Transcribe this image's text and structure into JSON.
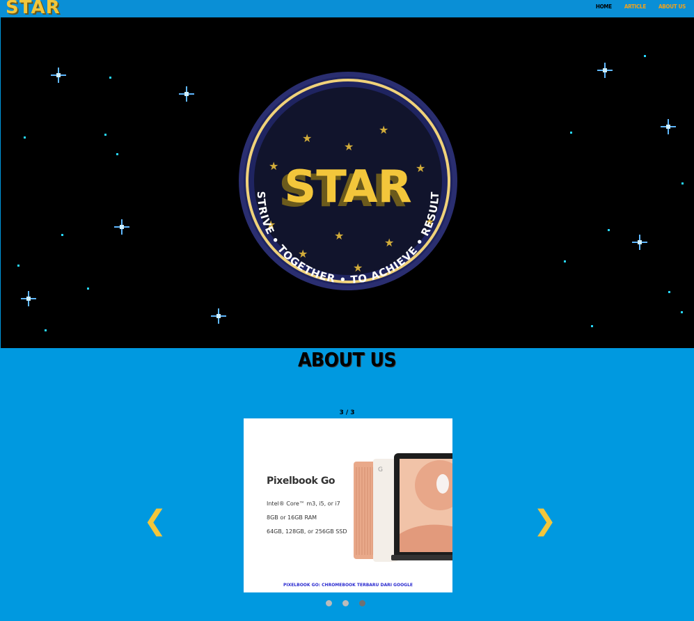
{
  "header": {
    "brand": "STAR",
    "nav": [
      {
        "label": "HOME",
        "active": true
      },
      {
        "label": "ARTICLE",
        "active": false
      },
      {
        "label": "ABOUT US",
        "active": false
      }
    ]
  },
  "hero": {
    "logo_word": "STAR",
    "logo_ring_text": "STRIVE • TOGETHER • TO ACHIEVE • RESULT"
  },
  "about": {
    "title": "ABOUT US"
  },
  "slideshow": {
    "counter": "3 / 3",
    "slide": {
      "heading": "Pixelbook Go",
      "specs": [
        "Intel® Core™ m3, i5, or i7",
        "8GB or 16GB RAM",
        "64GB, 128GB, or 256GB SSD"
      ],
      "caption": "PIXELBOOK GO: CHROMEBOOK TERBARU DARI GOOGLE"
    },
    "prev_symbol": "❮",
    "next_symbol": "❯",
    "dots_count": 3,
    "active_dot": 3
  },
  "colors": {
    "accent_yellow": "#f3c63b",
    "nav_orange": "#f3a21a",
    "page_blue": "#0099e0",
    "topbar_blue": "#0a8fd6",
    "logo_navy": "#1f2460"
  }
}
